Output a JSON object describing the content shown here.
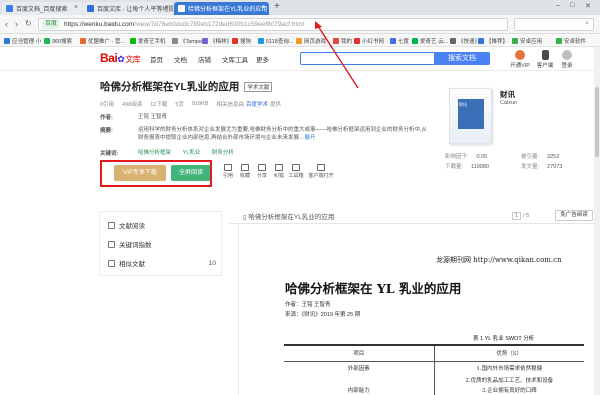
{
  "browser": {
    "tabs": [
      {
        "label": "百度文档_百度搜索",
        "color": "#3b7ded"
      },
      {
        "label": "百度文库 - 让每个人平等地提升自我",
        "color": "#2d6fe0"
      },
      {
        "label": "哈佛分析框架在YL乳业的应用",
        "color": "#ffffff"
      }
    ],
    "url_secure": "百度",
    "url_host": "https://wenku.baidu.com",
    "url_path": "/view/7d76eb0dcdc789eb172ded630b1c59eef8c79acf.html",
    "bookmarks": [
      {
        "label": "应当管理·小",
        "color": "#2f7bd8"
      },
      {
        "label": "360搜索",
        "color": "#19b955"
      },
      {
        "label": "优盟推广 - 营...",
        "color": "#e46b2a"
      },
      {
        "label": "爱奇艺手机",
        "color": "#00be06"
      },
      {
        "label": "《Tampe",
        "color": "#888888"
      },
      {
        "label": "《梅林》",
        "color": "#7b5cd6"
      },
      {
        "label": "搜狗",
        "color": "#e2362b"
      },
      {
        "label": "5118查询...",
        "color": "#1f9ae0"
      },
      {
        "label": "网页游戏",
        "color": "#f19a2b"
      },
      {
        "label": "我的",
        "color": "#e4473b"
      },
      {
        "label": "小红书网",
        "color": "#e0322f"
      },
      {
        "label": "七度",
        "color": "#3f6fe0"
      },
      {
        "label": "爱奇艺·云...",
        "color": "#00b54b"
      },
      {
        "label": "《快速》",
        "color": "#666666"
      },
      {
        "label": "【推荐】·",
        "color": "#2e78d8"
      },
      {
        "label": "安卓应用",
        "color": "#35b24a"
      },
      {
        "label": "安卓软件",
        "color": "#35b24a"
      }
    ]
  },
  "site": {
    "logo_main": "Bai",
    "logo_paw": "du",
    "logo_sub": "文库",
    "nav": [
      "首页",
      "文档",
      "店铺",
      "文库工具",
      "更多"
    ],
    "search_button": "搜索文档",
    "header_icons": [
      {
        "label": "开通VIP",
        "color": "#e8733a"
      },
      {
        "label": "客户端",
        "color": "#4a4a4a"
      },
      {
        "label": "登录",
        "color": "#bfbfbf"
      }
    ]
  },
  "doc": {
    "title": "哈佛分析框架在YL乳业的应用",
    "badge": "学术文献",
    "meta": [
      "0引用",
      "498阅读",
      "12下载",
      "5页",
      "818KB",
      "相关信息由",
      "百度学术",
      "提供"
    ],
    "author_key": "作者:",
    "authors": "王铭  王智青",
    "abstract_key": "摘要:",
    "abstract": "运用科学的财务分析体系对企业发展尤为重要,哈佛财务分析中的重大或事——哈佛分析框架运用到企业的财务分析中,从财务报表中提取企业内部信息,再结合外部市场环境与企业未来发展…",
    "abstract_more": "展开",
    "keywords_key": "关键词:",
    "keywords": [
      "哈佛分析框架",
      "YL乳业",
      "财务分析"
    ],
    "vip_button": "VIP专享下载",
    "read_button": "全屏阅读",
    "actions": [
      "引用",
      "收藏",
      "分享",
      "纠错",
      "工具箱",
      "客户端打开"
    ]
  },
  "journal": {
    "cover_text": "财讯",
    "name": "财讯",
    "sub": "Caixun",
    "stats": [
      {
        "k": "影响因子:",
        "v": "0.05"
      },
      {
        "k": "被引量:",
        "v": "3252"
      },
      {
        "k": "下载量:",
        "v": "119980"
      },
      {
        "k": "发文量:",
        "v": "27973"
      }
    ]
  },
  "sidebar": {
    "items": [
      {
        "label": "文献阅读",
        "count": ""
      },
      {
        "label": "关键词指数",
        "count": ""
      },
      {
        "label": "相似文献",
        "count": "10"
      }
    ]
  },
  "viewer": {
    "title": "哈佛分析框架在YL乳业的应用",
    "page_current": "1",
    "page_total": "/ 5",
    "button": "免广告阅读",
    "page": {
      "header": "龙源期刊网  http://www.qikan.com.cn",
      "title": "哈佛分析框架在 YL 乳业的应用",
      "authors_line": "作者：王铭  王智青",
      "source_line": "来源：《财讯》2019 年第 25 期",
      "table_caption": "表 1  YL 乳业 SWOT 分析",
      "table_header": [
        "项目",
        "优势（S）"
      ],
      "table_rows": [
        [
          "外部因素",
          "1.国内外市场需求依然稳健"
        ],
        [
          "",
          "2.优质的乳品加工工艺、技术和设备"
        ],
        [
          "内部能力",
          "3.企业拥有良好的口碑"
        ]
      ]
    }
  },
  "annotation": {
    "color": "#e3191e"
  }
}
